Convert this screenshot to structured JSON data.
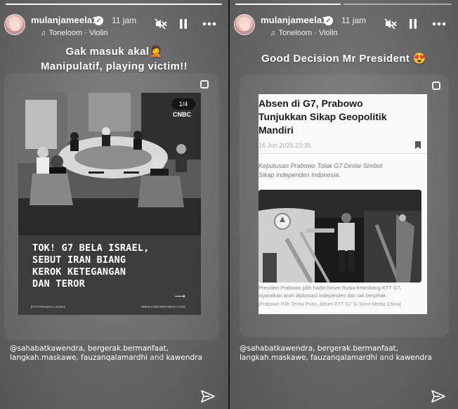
{
  "story_left": {
    "username": "mulanjameela1",
    "time": "11 jam",
    "audio": "Toneloom · Violin",
    "caption_line1": "Gak masuk akal🤦",
    "caption_line2": "Manipulatif, playing victim!!",
    "post": {
      "slide_indicator": "1/4",
      "logo_text": "CNBC",
      "headline": "TOK! G7 BELA ISRAEL,\nSEBUT IRAN BIANG\nKEROK KETEGANGAN\nDAN TEROR",
      "footer_left": "[FOTO/Reuters Lorusso]",
      "footer_right": "WWW.CNBCINDONESIA.COM",
      "arrow": "⟶"
    },
    "mentions": {
      "line1": "@sahabatkawendra, bergerak.bermanfaat,",
      "line2_handles": "langkah.maskawe, fauzanqalamardhi",
      "line2_and": " and ",
      "line2_last": "kawendra"
    }
  },
  "story_right": {
    "username": "mulanjameela1",
    "time": "11 jam",
    "audio": "Toneloom · Violin",
    "caption": "Good Decision Mr President 😍",
    "post": {
      "title": "Absen di G7, Prabowo\nTunjukkan Sikap Geopolitik\nMandiri",
      "date": "16 Jun 2025 23:35",
      "subtitle": "Keputusan Prabowo Tolak G7 Dinilai Simbol\nSikap Independen Indonesia.",
      "photo_caption": "Presiden Prabowo pilih hadiri forum Rusia ketimbang KTT G7,\nisyaratkan arah diplomasi independen dan tak berpihak.",
      "photo_link": "[Prabowo Pilih Temui Putin, Absen KTT G7 Si Sorot Media China]"
    },
    "mentions": {
      "line1": "@sahabatkawendra, bergerak.bermanfaat,",
      "line2_handles": "langkah.maskawe, fauzanqalamardhi",
      "line2_and": " and ",
      "line2_last": "kawendra"
    }
  },
  "icons": {
    "verified": "verified-badge",
    "mute": "speaker-muted",
    "pause": "pause",
    "more": "more-dots",
    "send": "paper-plane"
  }
}
